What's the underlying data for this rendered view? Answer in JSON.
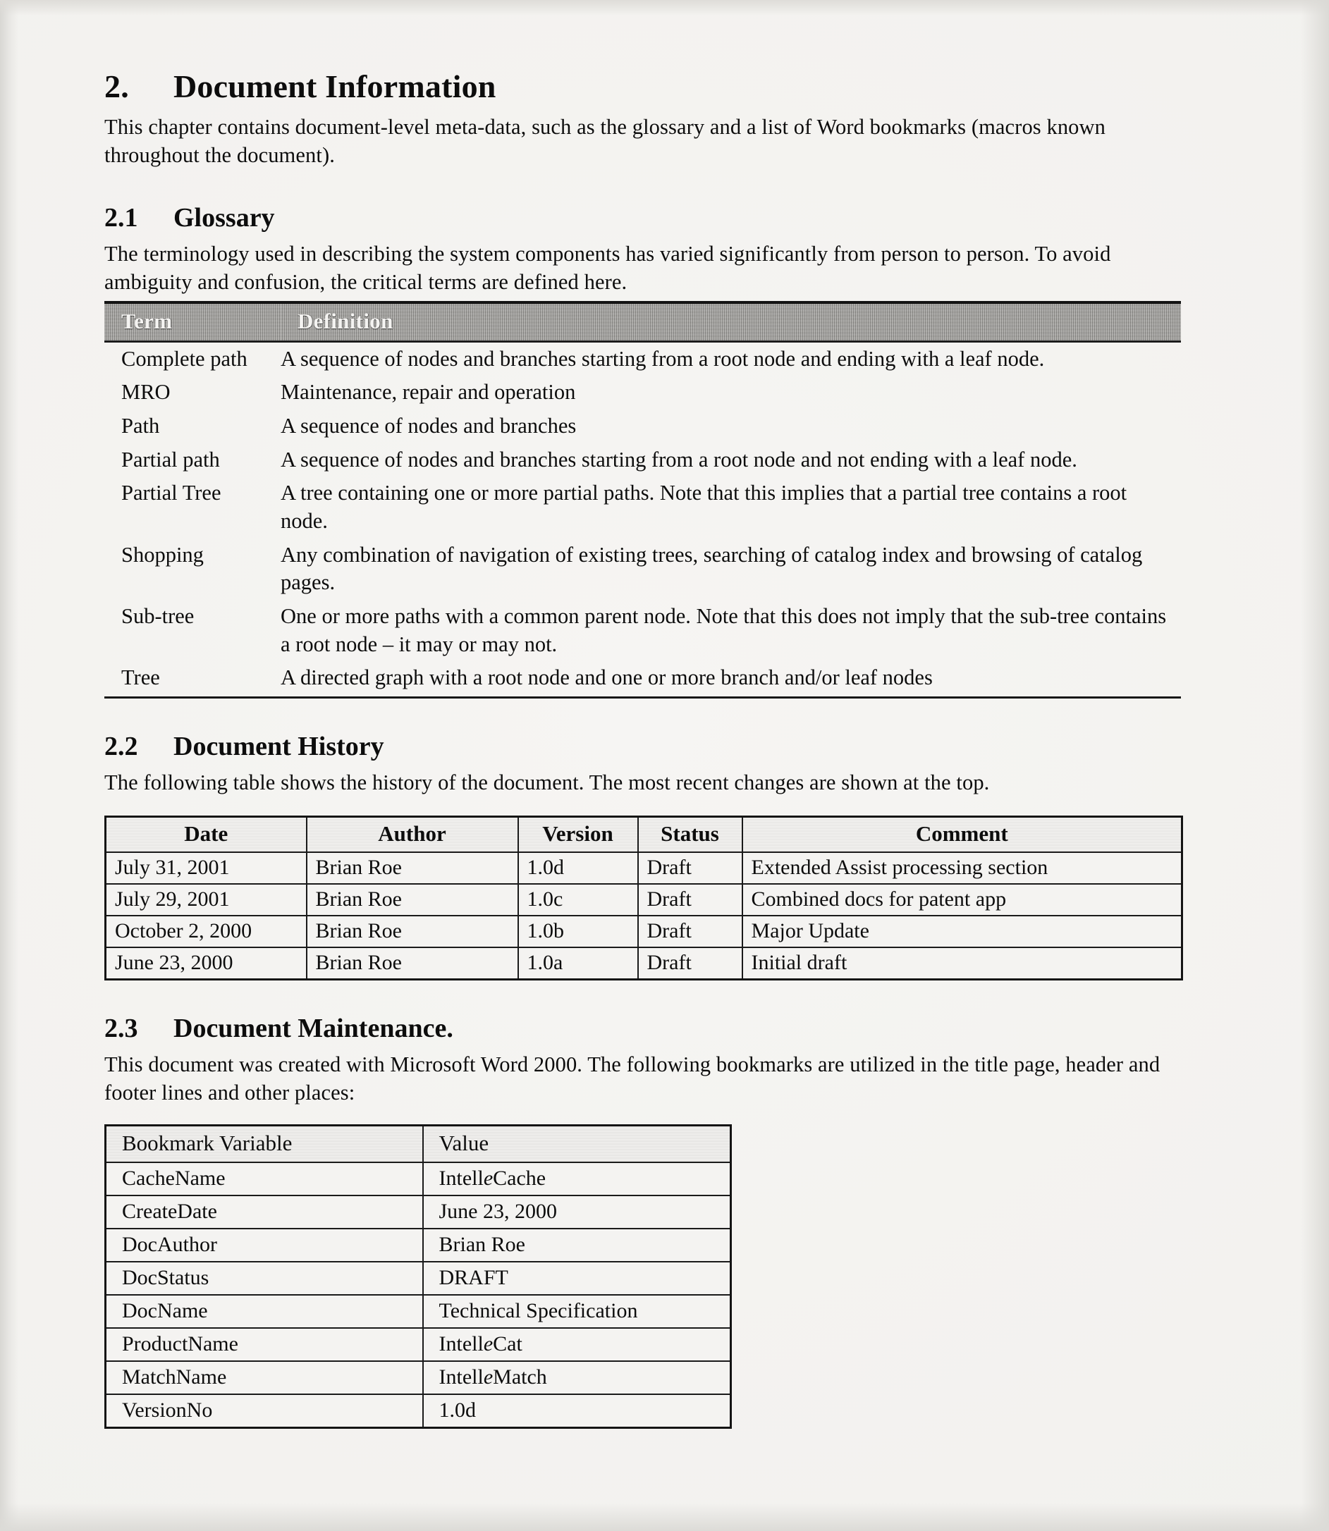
{
  "chapter": {
    "number": "2.",
    "title": "Document Information",
    "intro": "This chapter contains document-level meta-data, such as the glossary and a list of Word bookmarks (macros known throughout the document)."
  },
  "glossary": {
    "number": "2.1",
    "title": "Glossary",
    "intro": "The terminology used in describing the system components has varied significantly from person to person.  To avoid ambiguity and confusion, the critical terms are defined here.",
    "columns": [
      "Term",
      "Definition"
    ],
    "rows": [
      {
        "term": "Complete path",
        "definition": "A sequence of nodes and branches starting from a root node and ending with a leaf node."
      },
      {
        "term": "MRO",
        "definition": "Maintenance, repair and operation"
      },
      {
        "term": "Path",
        "definition": "A sequence of nodes and branches"
      },
      {
        "term": "Partial path",
        "definition": "A sequence of nodes and branches starting from a root node and not ending with a leaf node."
      },
      {
        "term": "Partial Tree",
        "definition": "A tree containing one or more partial paths.  Note that this implies that a partial tree contains a root node."
      },
      {
        "term": "Shopping",
        "definition": "Any combination of navigation of existing trees, searching of catalog index and browsing of catalog pages."
      },
      {
        "term": "Sub-tree",
        "definition": "One or more paths with a common parent node.  Note that this does not imply that the sub-tree contains a root node – it may or may not."
      },
      {
        "term": "Tree",
        "definition": "A directed graph with a root node and one or more branch and/or leaf nodes"
      }
    ]
  },
  "history": {
    "number": "2.2",
    "title": "Document History",
    "intro": "The following table shows the history of the document.  The most recent changes are shown at the top.",
    "columns": [
      "Date",
      "Author",
      "Version",
      "Status",
      "Comment"
    ],
    "rows": [
      {
        "date": "July 31, 2001",
        "author": "Brian Roe",
        "version": "1.0d",
        "status": "Draft",
        "comment": "Extended Assist processing section"
      },
      {
        "date": "July 29, 2001",
        "author": "Brian Roe",
        "version": "1.0c",
        "status": "Draft",
        "comment": "Combined docs for patent app"
      },
      {
        "date": "October 2, 2000",
        "author": "Brian Roe",
        "version": "1.0b",
        "status": "Draft",
        "comment": "Major Update"
      },
      {
        "date": "June 23, 2000",
        "author": "Brian Roe",
        "version": "1.0a",
        "status": "Draft",
        "comment": "Initial draft"
      }
    ]
  },
  "maintenance": {
    "number": "2.3",
    "title": "Document Maintenance.",
    "intro": "This document was created with Microsoft Word 2000. The following bookmarks are utilized in the title page, header and footer lines and other places:",
    "columns": [
      "Bookmark Variable",
      "Value"
    ],
    "rows": [
      {
        "variable": "CacheName",
        "value_pre": "Intell",
        "value_em": "e",
        "value_post": "Cache"
      },
      {
        "variable": "CreateDate",
        "value_pre": "June 23, 2000",
        "value_em": "",
        "value_post": ""
      },
      {
        "variable": "DocAuthor",
        "value_pre": "Brian Roe",
        "value_em": "",
        "value_post": ""
      },
      {
        "variable": "DocStatus",
        "value_pre": "DRAFT",
        "value_em": "",
        "value_post": ""
      },
      {
        "variable": "DocName",
        "value_pre": "Technical Specification",
        "value_em": "",
        "value_post": ""
      },
      {
        "variable": "ProductName",
        "value_pre": "Intell",
        "value_em": "e",
        "value_post": "Cat"
      },
      {
        "variable": "MatchName",
        "value_pre": "Intell",
        "value_em": "e",
        "value_post": "Match"
      },
      {
        "variable": "VersionNo",
        "value_pre": "1.0d",
        "value_em": "",
        "value_post": ""
      }
    ]
  }
}
